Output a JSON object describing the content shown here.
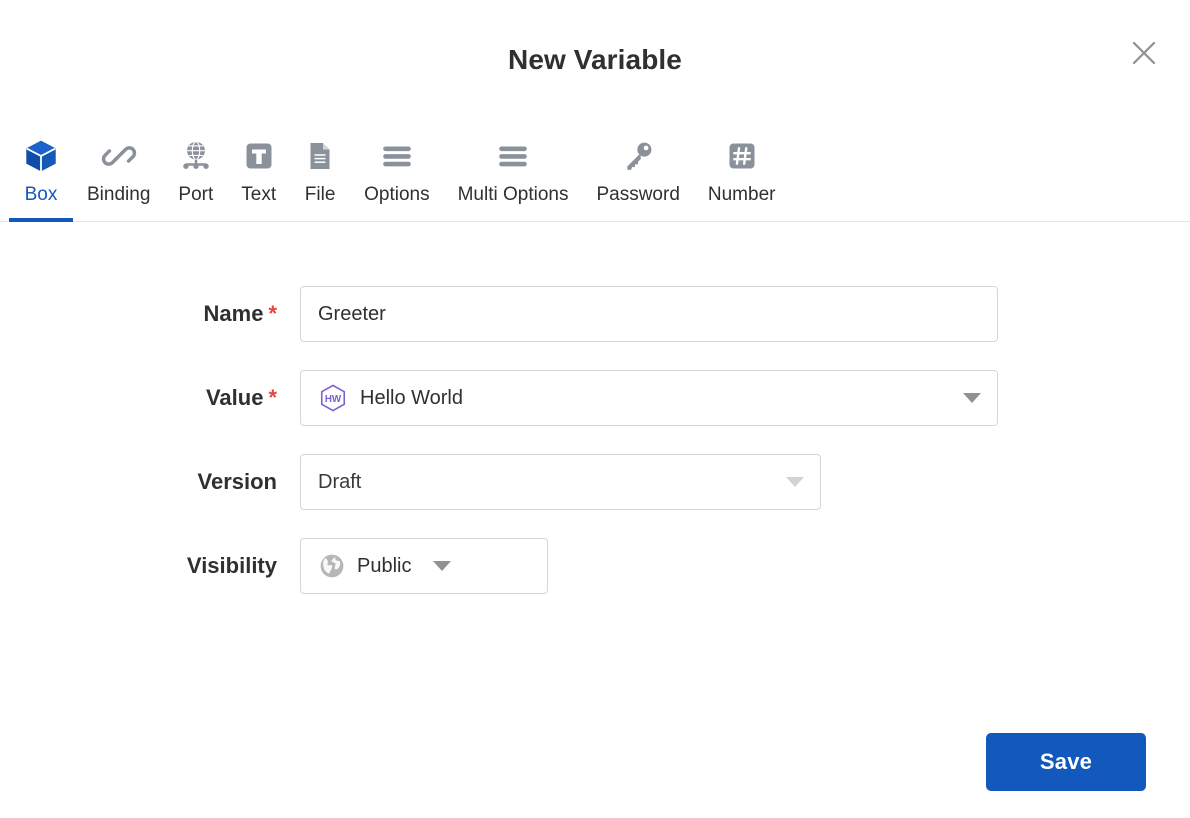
{
  "dialog": {
    "title": "New Variable",
    "close_icon": "close-icon"
  },
  "tabs": [
    {
      "label": "Box",
      "icon": "box-cube-icon",
      "active": true
    },
    {
      "label": "Binding",
      "icon": "link-chain-icon",
      "active": false
    },
    {
      "label": "Port",
      "icon": "globe-network-icon",
      "active": false
    },
    {
      "label": "Text",
      "icon": "text-t-icon",
      "active": false
    },
    {
      "label": "File",
      "icon": "file-document-icon",
      "active": false
    },
    {
      "label": "Options",
      "icon": "list-bars-icon",
      "active": false
    },
    {
      "label": "Multi Options",
      "icon": "list-bars-icon",
      "active": false
    },
    {
      "label": "Password",
      "icon": "key-icon",
      "active": false
    },
    {
      "label": "Number",
      "icon": "hash-number-icon",
      "active": false
    }
  ],
  "form": {
    "name": {
      "label": "Name",
      "required_marker": "*",
      "value": "Greeter",
      "placeholder": ""
    },
    "value": {
      "label": "Value",
      "required_marker": "*",
      "badge_text": "HW",
      "badge_icon": "hexagon-badge-icon",
      "selected": "Hello World",
      "caret_icon": "chevron-down-icon"
    },
    "version": {
      "label": "Version",
      "selected": "Draft",
      "caret_icon": "chevron-down-icon",
      "disabled": true
    },
    "visibility": {
      "label": "Visibility",
      "icon": "globe-icon",
      "selected": "Public",
      "caret_icon": "chevron-down-icon"
    }
  },
  "footer": {
    "save_label": "Save"
  },
  "colors": {
    "accent_blue": "#1258bd",
    "required_red": "#e8453c",
    "badge_purple": "#7b5fd4",
    "icon_gray": "#8b919b",
    "border_gray": "#d6d6d6"
  }
}
